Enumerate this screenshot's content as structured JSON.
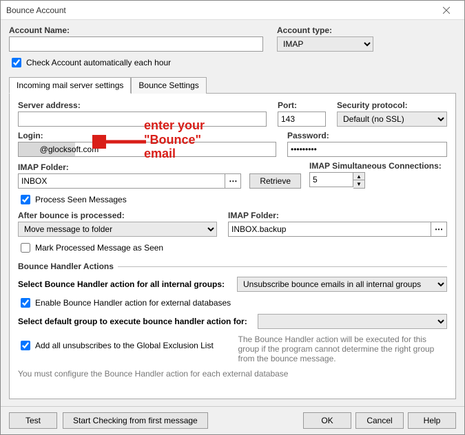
{
  "window": {
    "title": "Bounce Account"
  },
  "header": {
    "account_name_label": "Account Name:",
    "account_name_value": "",
    "account_type_label": "Account type:",
    "account_type_value": "IMAP",
    "check_account_label": "Check Account automatically each hour",
    "check_account_checked": true
  },
  "tabs": {
    "incoming": "Incoming mail server settings",
    "bounce": "Bounce Settings"
  },
  "server": {
    "server_address_label": "Server address:",
    "server_address_value": "",
    "port_label": "Port:",
    "port_value": "143",
    "security_label": "Security protocol:",
    "security_value": "Default (no SSL)",
    "login_label": "Login:",
    "login_value": "        @glocksoft.com",
    "password_label": "Password:",
    "password_value": "•••••••••",
    "imap_folder_label": "IMAP Folder:",
    "imap_folder_value": "INBOX",
    "retrieve_label": "Retrieve",
    "imap_conn_label": "IMAP Simultaneous Connections:",
    "imap_conn_value": "5",
    "process_seen_label": "Process Seen Messages",
    "process_seen_checked": true
  },
  "after": {
    "after_label": "After bounce is processed:",
    "after_value": "Move message to folder",
    "imap_folder_label": "IMAP Folder:",
    "imap_folder_value": "INBOX.backup",
    "mark_processed_label": "Mark Processed Message as Seen",
    "mark_processed_checked": false
  },
  "actions": {
    "section_title": "Bounce Handler Actions",
    "internal_label": "Select Bounce Handler action for all internal groups:",
    "internal_value": "Unsubscribe bounce emails in all internal groups",
    "enable_ext_label": "Enable Bounce Handler action for external databases",
    "enable_ext_checked": true,
    "default_group_label": "Select default group to execute bounce handler action for:",
    "default_group_value": "",
    "add_unsub_label": "Add all unsubscribes to the Global Exclusion List",
    "add_unsub_checked": true,
    "help_text": "The Bounce Handler action will be executed for this group if the program cannot determine the right group from the bounce message.",
    "note": "You must configure the Bounce Handler action for each external database"
  },
  "footer": {
    "test": "Test",
    "start": "Start Checking from first message",
    "ok": "OK",
    "cancel": "Cancel",
    "help": "Help"
  },
  "annotation": {
    "line1": "enter your",
    "line2": "\"Bounce\"",
    "line3": "email"
  }
}
